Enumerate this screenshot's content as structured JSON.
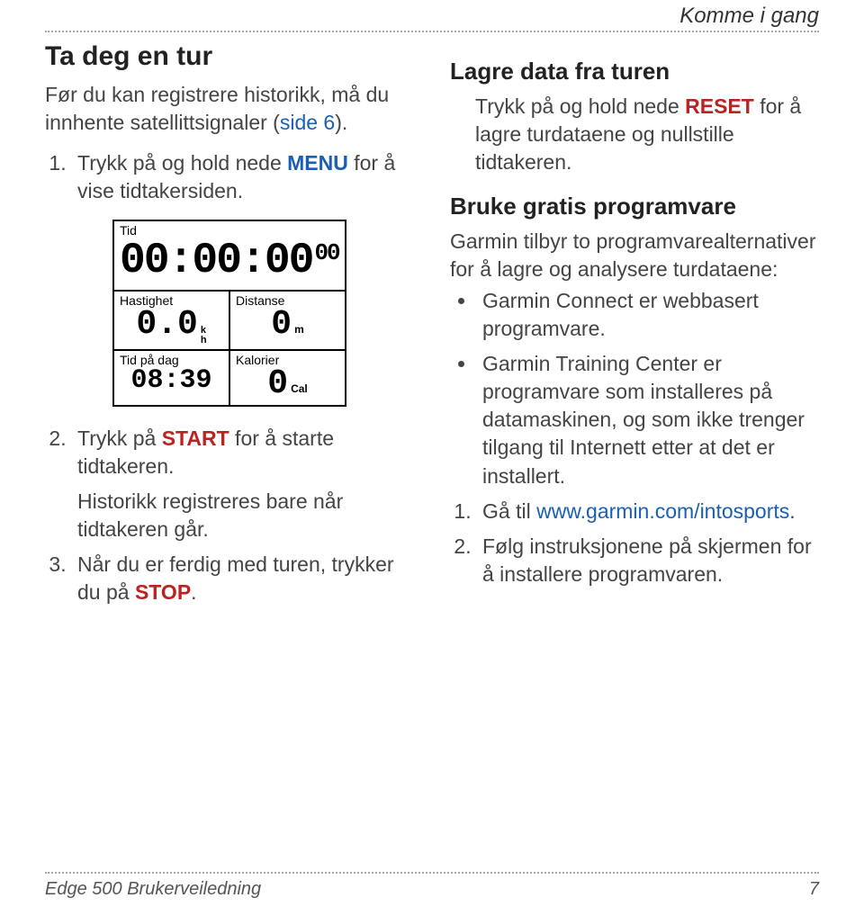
{
  "header": {
    "section_label": "Komme i gang"
  },
  "left": {
    "h1": "Ta deg en tur",
    "intro_pre": "Før du kan registrere historikk, må du innhente satellittsignaler (",
    "intro_link": "side 6",
    "intro_post": ").",
    "step1_pre": "Trykk på og hold nede ",
    "step1_kw": "MENU",
    "step1_post": " for å vise tidtakersiden.",
    "step2_pre": "Trykk på ",
    "step2_kw": "START",
    "step2_post": " for å starte tidtakeren.",
    "step2_sub": "Historikk registreres bare når tidtakeren går.",
    "step3_pre": "Når du er ferdig med turen, trykker du på ",
    "step3_kw": "STOP",
    "step3_post": "."
  },
  "device": {
    "tid_label": "Tid",
    "tid_value": "00:00:00",
    "tid_sup": "00",
    "hastighet_label": "Hastighet",
    "hastighet_value": "0.0",
    "hastighet_unit_top": "k",
    "hastighet_unit_bot": "h",
    "distanse_label": "Distanse",
    "distanse_value": "0",
    "distanse_unit": "m",
    "tidpadag_label": "Tid på dag",
    "tidpadag_value": "08:39",
    "kalorier_label": "Kalorier",
    "kalorier_value": "0",
    "kalorier_unit": "Cal"
  },
  "right": {
    "h2a": "Lagre data fra turen",
    "p1_pre": "Trykk på og hold nede ",
    "p1_kw": "RESET",
    "p1_post": " for å lagre turdataene og nullstille tidtakeren.",
    "h2b": "Bruke gratis programvare",
    "p2": "Garmin tilbyr to programvarealternativer for å lagre og analysere turdataene:",
    "b1": "Garmin Connect er webbasert programvare.",
    "b2": "Garmin Training Center er programvare som installeres på datamaskinen, og som ikke trenger tilgang til Internett etter at det er installert.",
    "s1_pre": "Gå til ",
    "s1_link": "www.garmin.com/intosports",
    "s1_post": ".",
    "s2": "Følg instruksjonene på skjermen for å installere programvaren."
  },
  "footer": {
    "left": "Edge 500 Brukerveiledning",
    "right": "7"
  }
}
